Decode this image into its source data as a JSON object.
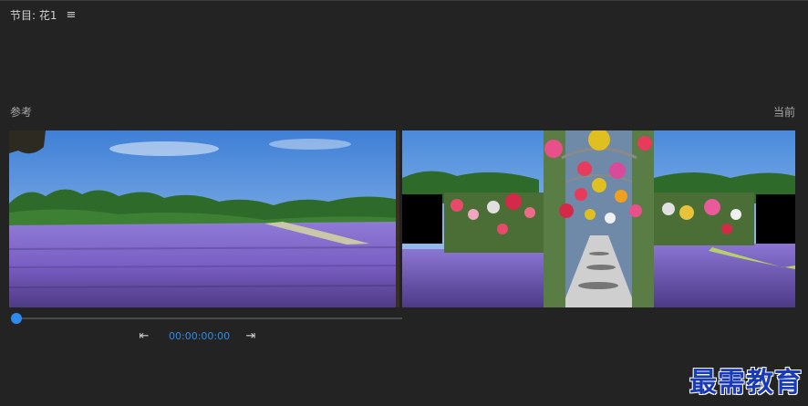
{
  "panel": {
    "title": "节目: 花1",
    "menu_icon": "hamburger-menu-icon"
  },
  "labels": {
    "reference": "参考",
    "current": "当前"
  },
  "transport": {
    "timecode": "00:00:00:00",
    "go_to_in_icon": "step-back-to-in-point-icon",
    "go_to_out_icon": "step-forward-to-out-point-icon"
  },
  "watermark": "最需教育",
  "colors": {
    "accent": "#2d8ceb",
    "background": "#232323"
  }
}
